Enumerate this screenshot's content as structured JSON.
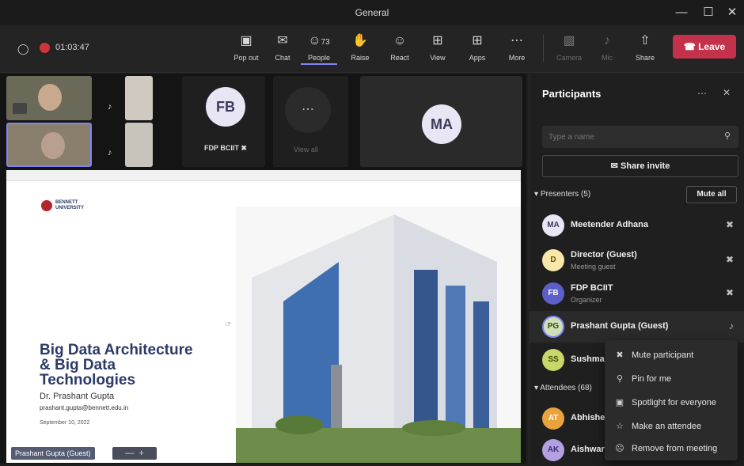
{
  "window": {
    "title": "General"
  },
  "toolbar": {
    "timer": "01:03:47",
    "items": [
      {
        "label": "Pop out",
        "icon": "popout-icon"
      },
      {
        "label": "Chat",
        "icon": "chat-icon"
      },
      {
        "label": "People",
        "icon": "people-icon",
        "count": "73"
      },
      {
        "label": "Raise",
        "icon": "hand-icon"
      },
      {
        "label": "React",
        "icon": "smile-icon"
      },
      {
        "label": "View",
        "icon": "grid-icon"
      },
      {
        "label": "Apps",
        "icon": "apps-icon"
      },
      {
        "label": "More",
        "icon": "more-icon"
      },
      {
        "label": "Camera",
        "icon": "camera-icon"
      },
      {
        "label": "Mic",
        "icon": "mic-icon"
      },
      {
        "label": "Share",
        "icon": "share-icon"
      }
    ],
    "leave_label": "Leave"
  },
  "stage": {
    "fb_initials": "FB",
    "fb_name": "FDP BCIIT",
    "view_all_label": "View all",
    "ma_initials": "MA",
    "presenter_label": "Prashant Gupta (Guest)",
    "slide": {
      "title": "Big Data Architecture & Big Data Technologies",
      "author": "Dr. Prashant Gupta",
      "email": "prashant.gupta@bennett.edu.in",
      "date": "September 10, 2022",
      "logo_text": "BENNETT UNIVERSITY"
    }
  },
  "panel": {
    "title": "Participants",
    "search_placeholder": "Type a name",
    "share_invite_label": "Share invite",
    "presenters_header": "Presenters (5)",
    "mute_all_label": "Mute all",
    "attendees_header": "Attendees (68)",
    "presenters": [
      {
        "initials": "MA",
        "name": "Meetender Adhana",
        "sub": "",
        "color": "#5b5fc7"
      },
      {
        "initials": "D",
        "name": "Director (Guest)",
        "sub": "Meeting guest",
        "color": "#c19c00"
      },
      {
        "initials": "FB",
        "name": "FDP BCIIT",
        "sub": "Organizer",
        "color": "#6264a7"
      },
      {
        "initials": "PG",
        "name": "Prashant Gupta (Guest)",
        "sub": "",
        "color": "#498205"
      },
      {
        "initials": "SS",
        "name": "Sushma",
        "sub": "",
        "color": "#7a9a01"
      }
    ],
    "attendees": [
      {
        "initials": "AT",
        "name": "Abhishe",
        "color": "#c19c00"
      },
      {
        "initials": "AK",
        "name": "Aishwar",
        "color": "#8764b8"
      }
    ]
  },
  "context_menu": [
    {
      "label": "Mute participant",
      "icon": "mic-off-icon"
    },
    {
      "label": "Pin for me",
      "icon": "pin-icon"
    },
    {
      "label": "Spotlight for everyone",
      "icon": "spotlight-icon"
    },
    {
      "label": "Make an attendee",
      "icon": "attendee-icon"
    },
    {
      "label": "Remove from meeting",
      "icon": "remove-person-icon"
    }
  ]
}
